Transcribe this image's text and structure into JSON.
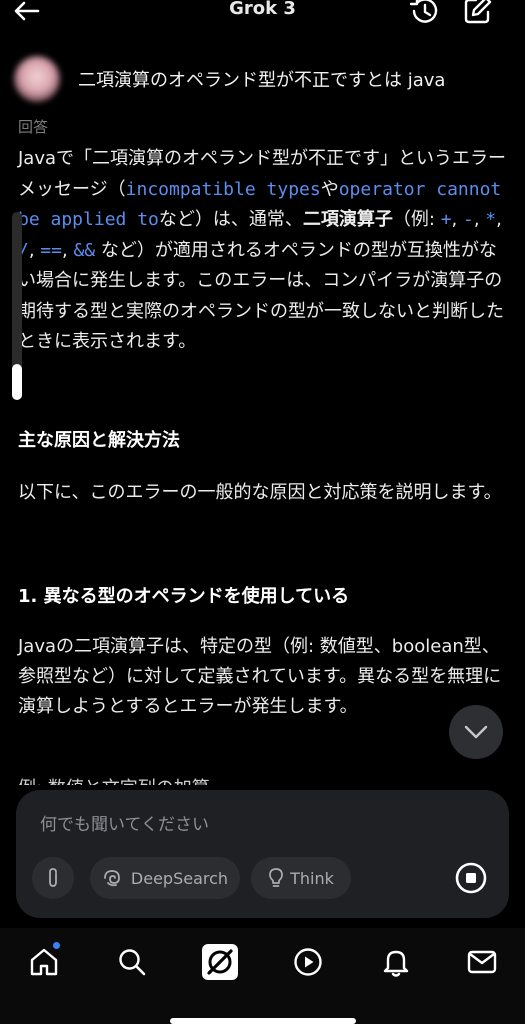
{
  "header": {
    "title": "Grok 3"
  },
  "conversation": {
    "user_question": "二項演算のオペランド型が不正ですとは java",
    "answer_label": "回答",
    "p1_a": "Javaで「二項演算のオペランド型が不正です」というエラーメッセージ（",
    "p1_code1": "incompatible types",
    "p1_b": "や",
    "p1_code2": "operator cannot be applied to",
    "p1_c": "など）は、通常、",
    "p1_bold": "二項演算子",
    "p1_d": "（例: ",
    "ops": [
      "+",
      "-",
      "*",
      "/",
      "==",
      "&&"
    ],
    "p1_e": " など）が適用されるオペランドの型が互換性がない場合に発生します。このエラーは、コンパイラが演算子の期待する型と実際のオペランドの型が一致しないと判断したときに表示されます。",
    "heading_causes": "主な原因と解決方法",
    "p2": "以下に、このエラーの一般的な原因と対応策を説明します。",
    "heading_1": "1. 異なる型のオペランドを使用している",
    "p3": "Javaの二項演算子は、特定の型（例: 数値型、boolean型、参照型など）に対して定義されています。異なる型を無理に演算しようとするとエラーが発生します。",
    "cut_text": "例: 数値と文字列の加算"
  },
  "composer": {
    "placeholder": "何でも聞いてください",
    "deepsearch_label": "DeepSearch",
    "think_label": "Think"
  },
  "icons": {
    "back": "arrow-left-icon",
    "history": "history-icon",
    "edit": "edit-icon",
    "scroll_down": "chevron-down-icon",
    "attach": "paperclip-icon",
    "deepsearch": "deepsearch-icon",
    "think": "lightbulb-icon",
    "stop": "stop-icon",
    "nav": [
      "home-icon",
      "search-icon",
      "grok-icon",
      "play-icon",
      "bell-icon",
      "mail-icon"
    ]
  },
  "colors": {
    "code": "#5b8def",
    "composer_bg": "#1e2024",
    "notification_dot": "#3a82f7"
  }
}
